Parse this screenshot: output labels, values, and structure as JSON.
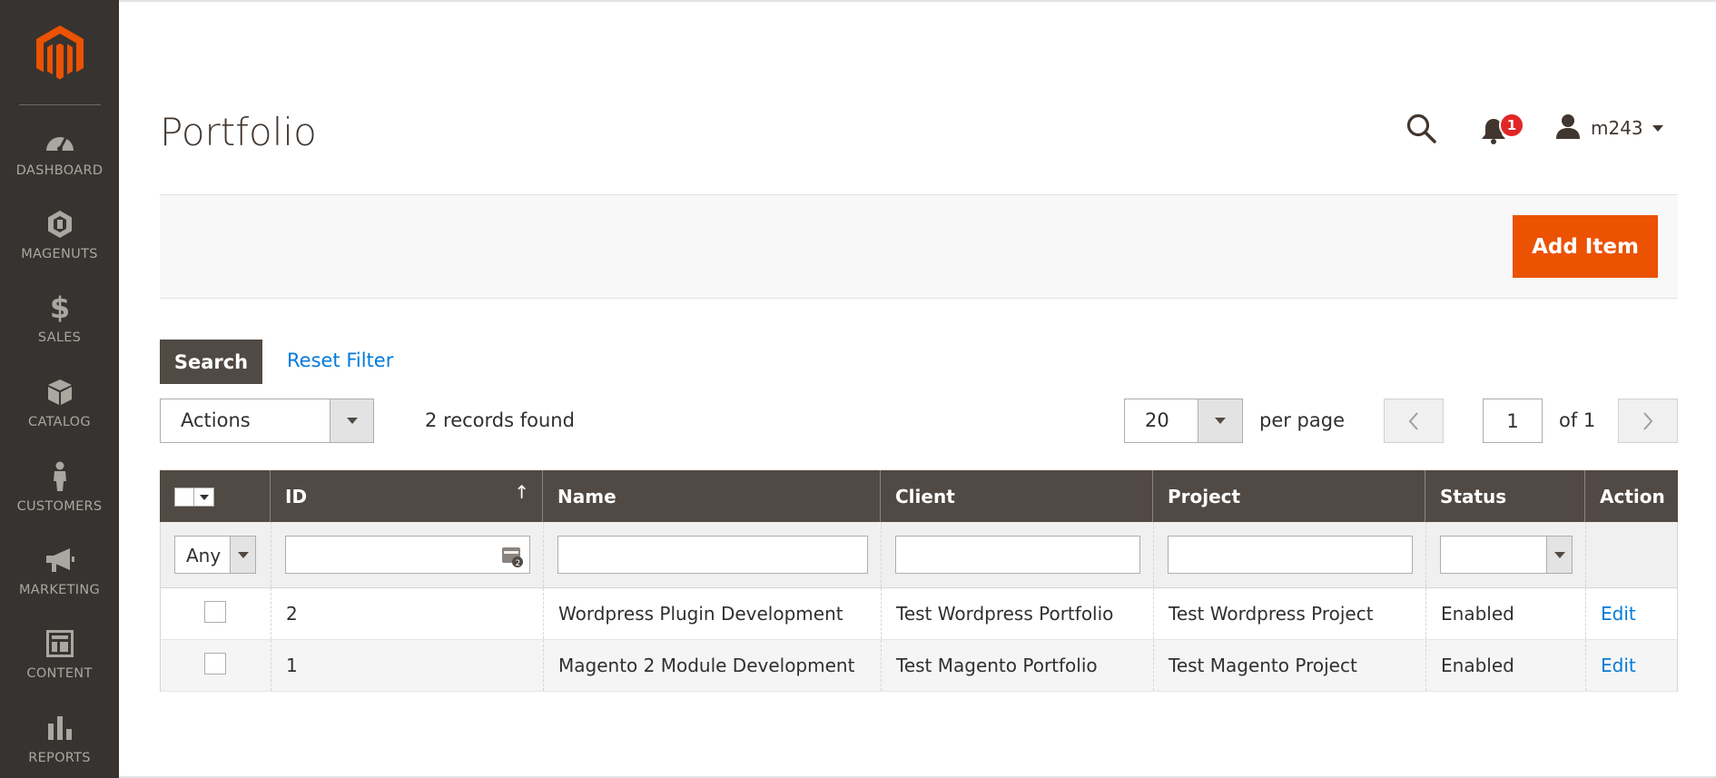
{
  "sidebar": {
    "items": [
      {
        "label": "DASHBOARD",
        "icon": "dashboard-icon"
      },
      {
        "label": "MAGENUTS",
        "icon": "magenuts-icon"
      },
      {
        "label": "SALES",
        "icon": "dollar-icon"
      },
      {
        "label": "CATALOG",
        "icon": "box-icon"
      },
      {
        "label": "CUSTOMERS",
        "icon": "person-icon"
      },
      {
        "label": "MARKETING",
        "icon": "megaphone-icon"
      },
      {
        "label": "CONTENT",
        "icon": "layout-icon"
      },
      {
        "label": "REPORTS",
        "icon": "bar-chart-icon"
      }
    ]
  },
  "header": {
    "title": "Portfolio",
    "notification_count": "1",
    "username": "m243"
  },
  "toolbar": {
    "add_label": "Add Item"
  },
  "filters": {
    "search_label": "Search",
    "reset_label": "Reset Filter"
  },
  "grid_controls": {
    "actions_label": "Actions",
    "records_found": "2 records found",
    "per_page_value": "20",
    "per_page_label": "per page",
    "current_page": "1",
    "of_pages": "of 1"
  },
  "table": {
    "columns": [
      "ID",
      "Name",
      "Client",
      "Project",
      "Status",
      "Action"
    ],
    "id_filter_any": "Any",
    "rows": [
      {
        "id": "2",
        "name": "Wordpress Plugin Development",
        "client": "Test Wordpress Portfolio",
        "project": "Test Wordpress Project",
        "status": "Enabled",
        "action": "Edit"
      },
      {
        "id": "1",
        "name": "Magento 2 Module Development",
        "client": "Test Magento Portfolio",
        "project": "Test Magento Project",
        "status": "Enabled",
        "action": "Edit"
      }
    ]
  },
  "colors": {
    "sidebar_bg": "#373330",
    "accent": "#eb5202",
    "header_bg": "#514943",
    "link": "#007bdb",
    "badge": "#e22626"
  }
}
